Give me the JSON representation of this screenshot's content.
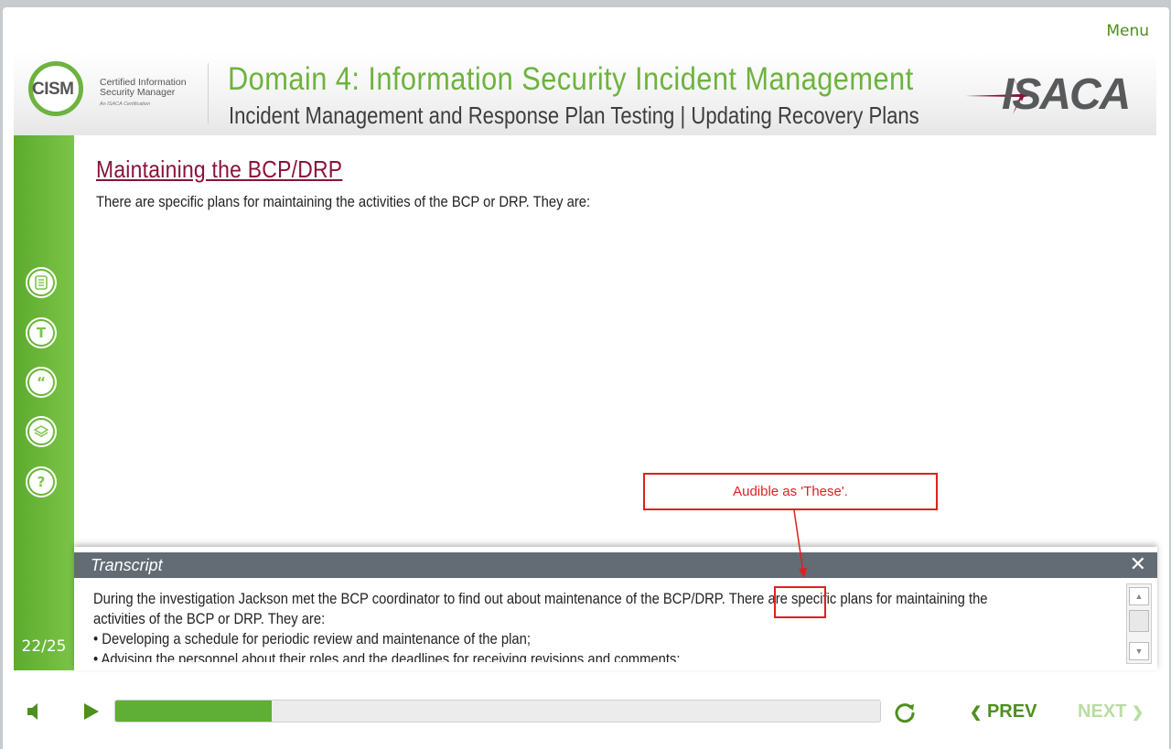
{
  "menu_label": "Menu",
  "header": {
    "logo_left": {
      "badge": "CISM",
      "line1": "Certified Information",
      "line2": "Security Manager",
      "sub": "An ISACA Certification"
    },
    "title": "Domain 4: Information Security Incident Management",
    "subtitle": "Incident Management and Response Plan Testing | Updating Recovery Plans",
    "logo_right": "ISACA"
  },
  "sidebar": {
    "icons": [
      "notes-icon",
      "glossary-icon",
      "quote-icon",
      "resources-icon",
      "help-icon"
    ],
    "icon_glyphs": [
      "",
      "T",
      "“",
      "",
      "?"
    ],
    "page_count": "22/25"
  },
  "slide": {
    "title": "Maintaining the BCP/DRP",
    "intro": "There are specific plans for maintaining the activities of the BCP or DRP. They are:"
  },
  "annotation": {
    "text": "Audible as 'These'.",
    "color": "#e02020"
  },
  "transcript": {
    "title": "Transcript",
    "close": "✕",
    "lines": [
      "During the investigation Jackson met the BCP coordinator to find out about maintenance of the BCP/DRP. There are specific plans for maintaining the",
      "activities of the BCP or DRP. They are:",
      "•  Developing a schedule for periodic review and maintenance of the plan;",
      "•  Advising the personnel about their roles and the deadlines for receiving revisions and comments;"
    ]
  },
  "player": {
    "progress": 0.205,
    "prev_label": "PREV",
    "next_label": "NEXT",
    "accent": "#5fae35"
  }
}
